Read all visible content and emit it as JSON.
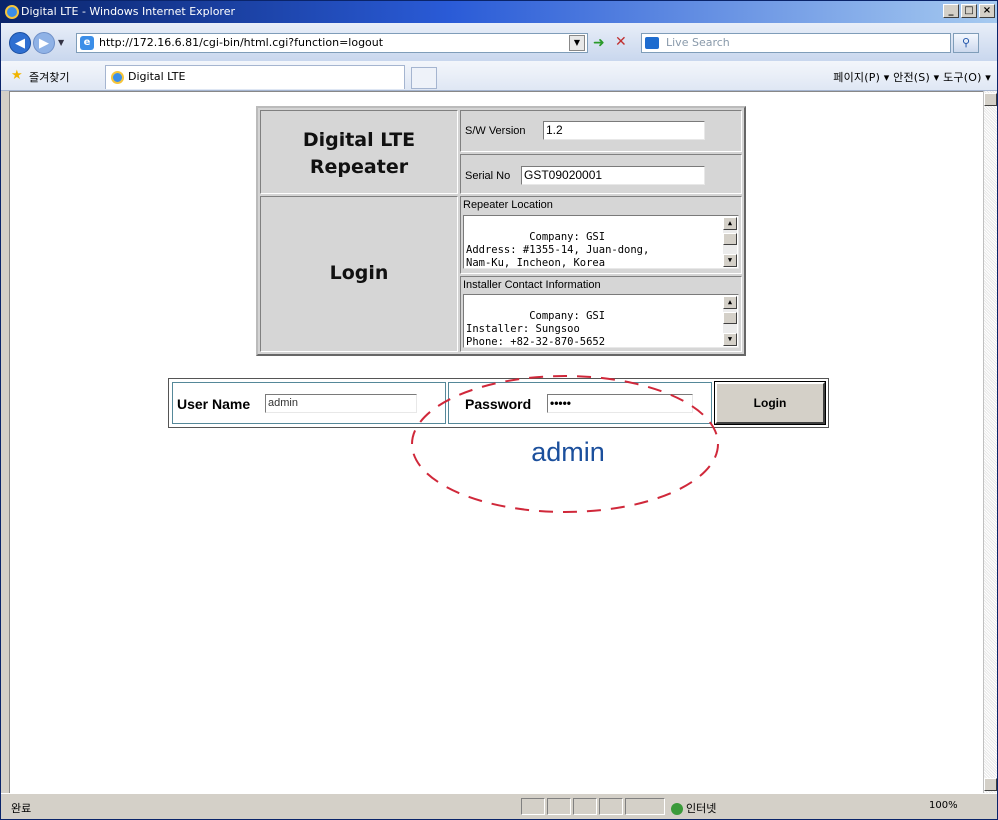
{
  "window": {
    "title": "Digital LTE - Windows Internet Explorer",
    "buttons": [
      "_",
      "□",
      "×"
    ]
  },
  "address_bar": {
    "url": "http://172.16.6.81/cgi-bin/html.cgi?function=logout",
    "search_placeholder": "Live Search"
  },
  "favorites": {
    "label": "즐겨찾기",
    "tab_title": "Digital LTE"
  },
  "command_bar": {
    "text": "페이지(P) ▾  안전(S) ▾  도구(O) ▾"
  },
  "page": {
    "device_title_line1": "Digital LTE",
    "device_title_line2": "Repeater",
    "login_title": "Login",
    "sw_version_label": "S/W Version",
    "sw_version_value": "1.2",
    "serial_label": "Serial No",
    "serial_value": "GST09020001",
    "location_label": "Repeater Location",
    "location_text": "Company: GSI\nAddress: #1355-14, Juan-dong,\nNam-Ku, Incheon, Korea",
    "installer_label": "Installer Contact Information",
    "installer_text": "Company: GSI\nInstaller: Sungsoo\nPhone: +82-32-870-5652",
    "username_label": "User Name",
    "username_value": "admin",
    "password_label": "Password",
    "password_value": "•••••",
    "login_button": "Login",
    "annotation": "admin"
  },
  "status_bar": {
    "status": "완료",
    "zone": "인터넷",
    "zoom": "100%"
  },
  "colors": {
    "annotation_dash": "#d0283a",
    "annotation_text": "#1b4f9c",
    "title_bar": "#0a246a"
  }
}
